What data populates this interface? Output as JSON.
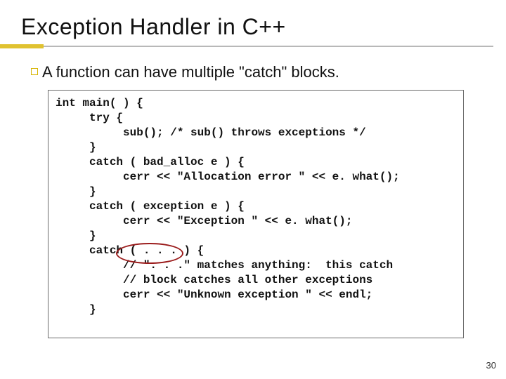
{
  "title": "Exception Handler in C++",
  "bullet": "A function can have multiple \"catch\" blocks.",
  "code": "int main( ) {\n     try {\n          sub(); /* sub() throws exceptions */\n     }\n     catch ( bad_alloc e ) {\n          cerr << \"Allocation error \" << e. what();\n     }\n     catch ( exception e ) {\n          cerr << \"Exception \" << e. what();\n     }\n     catch ( . . . ) {\n          // \". . .\" matches anything:  this catch\n          // block catches all other exceptions\n          cerr << \"Unknown exception \" << endl;\n     }",
  "page_number": "30"
}
